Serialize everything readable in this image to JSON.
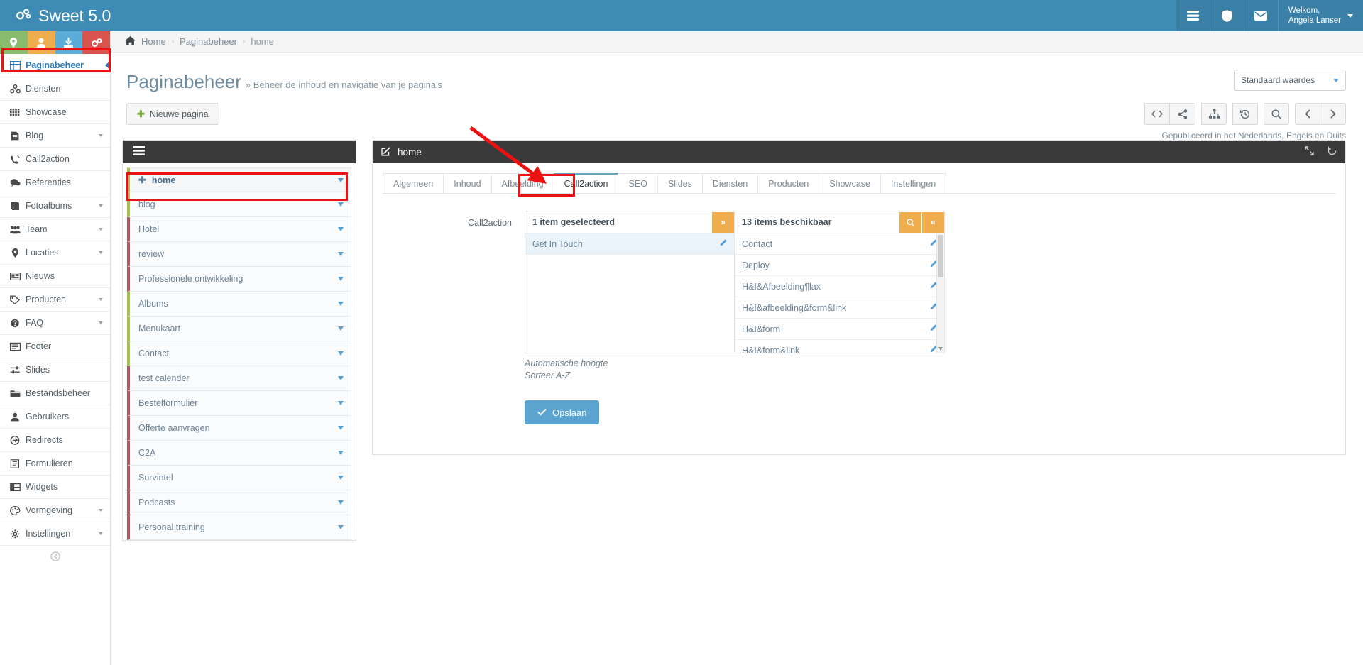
{
  "topbar": {
    "brand": "Sweet 5.0",
    "brand_icon": "gears-icon",
    "buttons": [
      {
        "name": "grid-view-icon",
        "glyph": "▤"
      },
      {
        "name": "shield-icon",
        "glyph": "❦"
      },
      {
        "name": "envelope-icon",
        "glyph": "✉"
      }
    ],
    "user_greeting": "Welkom,",
    "user_name": "Angela Lanser"
  },
  "quick_actions": [
    {
      "name": "location-pin-icon",
      "glyph": "●",
      "color": "#89bb6d"
    },
    {
      "name": "user-icon",
      "glyph": "●",
      "color": "#f0ad4e"
    },
    {
      "name": "download-icon",
      "glyph": "●",
      "color": "#5bacd8"
    },
    {
      "name": "settings-gears-icon",
      "glyph": "●",
      "color": "#d9534f"
    }
  ],
  "sidebar": {
    "items": [
      {
        "label": "Paginabeheer",
        "icon": "table-icon",
        "active": true,
        "caret": false
      },
      {
        "label": "Diensten",
        "icon": "services-icon",
        "active": false,
        "caret": false
      },
      {
        "label": "Showcase",
        "icon": "grid-icon",
        "active": false,
        "caret": false
      },
      {
        "label": "Blog",
        "icon": "document-icon",
        "active": false,
        "caret": true
      },
      {
        "label": "Call2action",
        "icon": "phone-icon",
        "active": false,
        "caret": false
      },
      {
        "label": "Referenties",
        "icon": "comment-icon",
        "active": false,
        "caret": false
      },
      {
        "label": "Fotoalbums",
        "icon": "book-icon",
        "active": false,
        "caret": true
      },
      {
        "label": "Team",
        "icon": "users-icon",
        "active": false,
        "caret": true
      },
      {
        "label": "Locaties",
        "icon": "map-pin-icon",
        "active": false,
        "caret": true
      },
      {
        "label": "Nieuws",
        "icon": "newspaper-icon",
        "active": false,
        "caret": false
      },
      {
        "label": "Producten",
        "icon": "tags-icon",
        "active": false,
        "caret": true
      },
      {
        "label": "FAQ",
        "icon": "question-icon",
        "active": false,
        "caret": true
      },
      {
        "label": "Footer",
        "icon": "list-icon",
        "active": false,
        "caret": false
      },
      {
        "label": "Slides",
        "icon": "sliders-icon",
        "active": false,
        "caret": false
      },
      {
        "label": "Bestandsbeheer",
        "icon": "folder-icon",
        "active": false,
        "caret": false
      },
      {
        "label": "Gebruikers",
        "icon": "user-icon",
        "active": false,
        "caret": false
      },
      {
        "label": "Redirects",
        "icon": "arrow-circle-icon",
        "active": false,
        "caret": false
      },
      {
        "label": "Formulieren",
        "icon": "form-icon",
        "active": false,
        "caret": false
      },
      {
        "label": "Widgets",
        "icon": "widgets-icon",
        "active": false,
        "caret": false
      },
      {
        "label": "Vormgeving",
        "icon": "palette-icon",
        "active": false,
        "caret": true
      },
      {
        "label": "Instellingen",
        "icon": "gear-icon",
        "active": false,
        "caret": true
      }
    ]
  },
  "breadcrumb": {
    "home_icon": "home-icon",
    "items": [
      "Home",
      "Paginabeheer",
      "home"
    ]
  },
  "page": {
    "title": "Paginabeheer",
    "subtitle": "» Beheer de inhoud en navigatie van je pagina's",
    "standard_select": "Standaard waardes",
    "new_page_button": "Nieuwe pagina",
    "publish_note": "Gepubliceerd in het Nederlands, Engels en Duits"
  },
  "toolbar_icons": [
    {
      "name": "code-icon",
      "glyph": "</>"
    },
    {
      "name": "share-icon",
      "glyph": "⛓"
    },
    {
      "name": "sitemap-icon",
      "glyph": "⑂"
    },
    {
      "name": "history-icon",
      "glyph": "↺"
    },
    {
      "name": "search-icon",
      "glyph": "⚲"
    },
    {
      "name": "prev-icon",
      "glyph": "‹"
    },
    {
      "name": "next-icon",
      "glyph": "›"
    }
  ],
  "tree": {
    "header_icon": "hamburger-icon",
    "items": [
      {
        "label": "home",
        "color": "green",
        "home": true
      },
      {
        "label": "blog",
        "color": "green",
        "home": false
      },
      {
        "label": "Hotel",
        "color": "red",
        "home": false
      },
      {
        "label": "review",
        "color": "red",
        "home": false
      },
      {
        "label": "Professionele ontwikkeling",
        "color": "red",
        "home": false
      },
      {
        "label": "Albums",
        "color": "green",
        "home": false
      },
      {
        "label": "Menukaart",
        "color": "green",
        "home": false
      },
      {
        "label": "Contact",
        "color": "green",
        "home": false
      },
      {
        "label": "test calender",
        "color": "red",
        "home": false
      },
      {
        "label": "Bestelformulier",
        "color": "red",
        "home": false
      },
      {
        "label": "Offerte aanvragen",
        "color": "red",
        "home": false
      },
      {
        "label": "C2A",
        "color": "red",
        "home": false
      },
      {
        "label": "Survintel",
        "color": "red",
        "home": false
      },
      {
        "label": "Podcasts",
        "color": "red",
        "home": false
      },
      {
        "label": "Personal training",
        "color": "red",
        "home": false
      }
    ]
  },
  "editor": {
    "title": "home",
    "title_icon": "edit-icon",
    "expand_icon": "expand-icon",
    "refresh_icon": "refresh-icon",
    "tabs": [
      {
        "label": "Algemeen",
        "active": false
      },
      {
        "label": "Inhoud",
        "active": false
      },
      {
        "label": "Afbeelding",
        "active": false
      },
      {
        "label": "Call2action",
        "active": true
      },
      {
        "label": "SEO",
        "active": false
      },
      {
        "label": "Slides",
        "active": false
      },
      {
        "label": "Diensten",
        "active": false
      },
      {
        "label": "Producten",
        "active": false
      },
      {
        "label": "Showcase",
        "active": false
      },
      {
        "label": "Instellingen",
        "active": false
      }
    ],
    "field_label": "Call2action",
    "selected_panel": {
      "header": "1 item geselecteerd",
      "move_button_icon": "chevron-double-right-icon",
      "move_button_glyph": "»",
      "items": [
        {
          "label": "Get In Touch",
          "edit_icon": "pencil-icon"
        }
      ]
    },
    "available_panel": {
      "header": "13 items beschikbaar",
      "search_button_icon": "search-icon",
      "search_button_glyph": "⚲",
      "move_button_icon": "chevron-double-left-icon",
      "move_button_glyph": "«",
      "items": [
        {
          "label": "Contact",
          "edit_icon": "pencil-icon"
        },
        {
          "label": "Deploy",
          "edit_icon": "pencil-icon"
        },
        {
          "label": "H&I&Afbeelding¶lax",
          "edit_icon": "pencil-icon"
        },
        {
          "label": "H&I&afbeelding&form&link",
          "edit_icon": "pencil-icon"
        },
        {
          "label": "H&I&form",
          "edit_icon": "pencil-icon"
        },
        {
          "label": "H&I&form&link",
          "edit_icon": "pencil-icon"
        }
      ]
    },
    "hints": [
      "Automatische hoogte",
      "Sorteer A-Z"
    ],
    "save_button": "Opslaan",
    "save_icon": "check-icon"
  },
  "colors": {
    "brand_blue": "#3e8bb5",
    "accent_orange": "#f0ad4e",
    "save_blue": "#5ba4cf",
    "annotation_red": "#ee1111",
    "tree_green": "#a9c24f",
    "tree_red": "#b05a62"
  }
}
